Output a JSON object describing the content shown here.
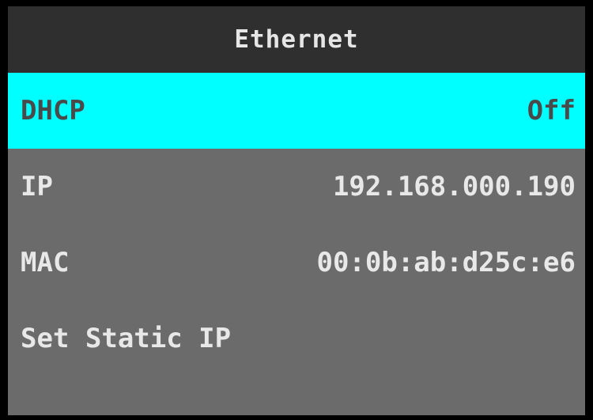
{
  "header": {
    "title": "Ethernet"
  },
  "menu": {
    "items": [
      {
        "label": "DHCP",
        "value": "Off",
        "selected": true
      },
      {
        "label": "IP",
        "value": "192.168.000.190",
        "selected": false
      },
      {
        "label": "MAC",
        "value": "00:0b:ab:d25c:e6",
        "selected": false
      },
      {
        "label": "Set Static IP",
        "value": "",
        "selected": false
      }
    ]
  },
  "colors": {
    "selected_background": "#00ffff",
    "panel_background": "#6b6b6b",
    "title_background": "#2f2f2f"
  }
}
